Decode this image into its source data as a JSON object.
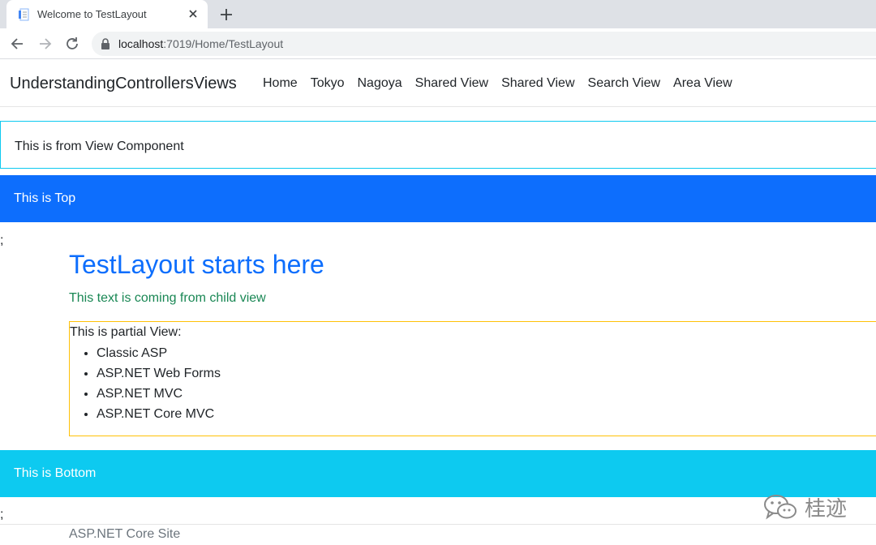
{
  "browser": {
    "tab_title": "Welcome to TestLayout",
    "url_host": "localhost",
    "url_rest": ":7019/Home/TestLayout"
  },
  "navbar": {
    "brand": "UnderstandingControllersViews",
    "links": [
      "Home",
      "Tokyo",
      "Nagoya",
      "Shared View",
      "Shared View",
      "Search View",
      "Area View"
    ]
  },
  "view_component": {
    "text": "This is from View Component"
  },
  "top_section": {
    "text": "This is Top"
  },
  "separator": ";",
  "content": {
    "title": "TestLayout starts here",
    "child_text": "This text is coming from child view"
  },
  "partial": {
    "heading": "This is partial View:",
    "items": [
      "Classic ASP",
      "ASP.NET Web Forms",
      "ASP.NET MVC",
      "ASP.NET Core MVC"
    ]
  },
  "bottom_section": {
    "text": "This is Bottom"
  },
  "footer": {
    "text": "ASP.NET Core Site"
  },
  "watermark": {
    "text": "桂迹"
  },
  "colors": {
    "primary": "#0d6efd",
    "info": "#0dcaf0",
    "success": "#198754",
    "warning": "#ffc107"
  }
}
